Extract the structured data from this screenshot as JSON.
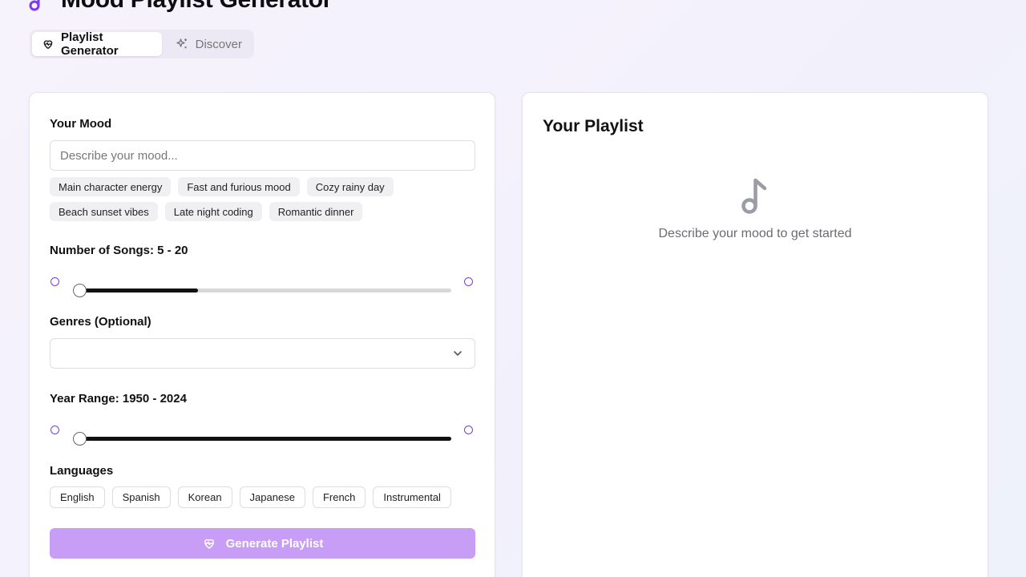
{
  "header": {
    "title": "Mood Playlist Generator",
    "logo_icon": "music-note-icon"
  },
  "tabs": [
    {
      "label": "Playlist Generator",
      "icon": "heart-pulse-icon",
      "active": true
    },
    {
      "label": "Discover",
      "icon": "sparkles-icon",
      "active": false
    }
  ],
  "form": {
    "mood": {
      "label": "Your Mood",
      "placeholder": "Describe your mood...",
      "value": "",
      "suggestions": [
        "Main character energy",
        "Fast and furious mood",
        "Cozy rainy day",
        "Beach sunset vibes",
        "Late night coding",
        "Romantic dinner"
      ]
    },
    "songs": {
      "label": "Number of Songs: 5 - 20",
      "min": 5,
      "max": 20,
      "range_fill_fraction": 0.32
    },
    "genres": {
      "label": "Genres (Optional)",
      "selected": ""
    },
    "years": {
      "label": "Year Range: 1950 - 2024",
      "min": 1950,
      "max": 2024,
      "range_fill_fraction": 1.0
    },
    "languages": {
      "label": "Languages",
      "options": [
        "English",
        "Spanish",
        "Korean",
        "Japanese",
        "French",
        "Instrumental"
      ]
    },
    "generate": {
      "label": "Generate Playlist"
    }
  },
  "playlist": {
    "title": "Your Playlist",
    "empty_text": "Describe your mood to get started",
    "empty_icon": "music-note-icon"
  },
  "colors": {
    "accent": "#7c3aed",
    "button_disabled": "#c89df5",
    "slider_fill": "#111111"
  }
}
